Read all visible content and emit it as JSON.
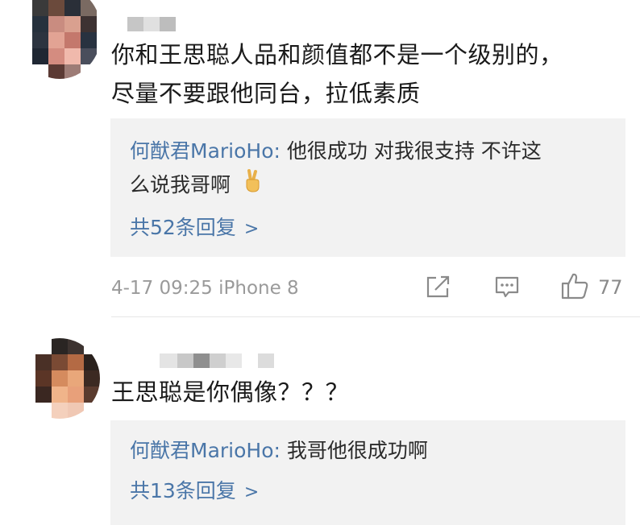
{
  "comments": [
    {
      "text_lines": [
        "你和王思聪人品和颜值都不是一个级别的，",
        "尽量不要跟他同台，拉低素质"
      ],
      "reply": {
        "author": "何猷君MarioHo:",
        "text_line1": " 他很成功 对我很支持 不许这",
        "text_line2": "么说我哥啊",
        "emoji_icon": "victory-hand-icon"
      },
      "more_replies": "共52条回复",
      "meta": "4-17 09:25 iPhone 8",
      "likes": "77"
    },
    {
      "text_lines": [
        "王思聪是你偶像？？？"
      ],
      "reply": {
        "author": "何猷君MarioHo:",
        "text_line1": " 我哥他很成功啊"
      },
      "more_replies": "共13条回复"
    }
  ],
  "colors": {
    "link": "#4a76a8",
    "reply_bg": "#f2f2f2",
    "meta_text": "#9a9a9a"
  }
}
